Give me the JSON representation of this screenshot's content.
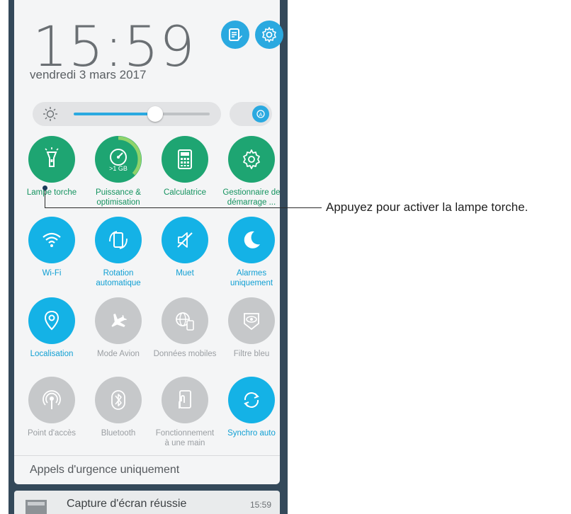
{
  "header": {
    "time": "15:59",
    "date": "vendredi 3 mars 2017",
    "edit_icon": "edit-note-icon",
    "settings_icon": "gear-icon"
  },
  "brightness": {
    "level": 0.6,
    "auto_icon": "auto-brightness-icon"
  },
  "tiles": [
    {
      "label": "Lampe torche",
      "icon": "flashlight-icon",
      "state": "green"
    },
    {
      "label": "Puissance & optimisation",
      "icon": "speedometer-icon",
      "state": "green",
      "badge": ">1 GB"
    },
    {
      "label": "Calculatrice",
      "icon": "calculator-icon",
      "state": "green"
    },
    {
      "label": "Gestionnaire de démarrage ...",
      "icon": "startup-gear-icon",
      "state": "green"
    },
    {
      "label": "Wi-Fi",
      "icon": "wifi-icon",
      "state": "blue"
    },
    {
      "label": "Rotation automatique",
      "icon": "rotation-icon",
      "state": "blue"
    },
    {
      "label": "Muet",
      "icon": "mute-icon",
      "state": "blue"
    },
    {
      "label": "Alarmes uniquement",
      "icon": "moon-icon",
      "state": "blue"
    },
    {
      "label": "Localisation",
      "icon": "location-pin-icon",
      "state": "blue"
    },
    {
      "label": "Mode Avion",
      "icon": "airplane-icon",
      "state": "gray"
    },
    {
      "label": "Données mobiles",
      "icon": "mobile-data-icon",
      "state": "gray"
    },
    {
      "label": "Filtre bleu",
      "icon": "eye-filter-icon",
      "state": "gray"
    },
    {
      "label": "Point d'accès",
      "icon": "hotspot-icon",
      "state": "gray"
    },
    {
      "label": "Bluetooth",
      "icon": "bluetooth-icon",
      "state": "gray"
    },
    {
      "label": "Fonctionnement à une main",
      "icon": "one-hand-icon",
      "state": "gray"
    },
    {
      "label": "Synchro auto",
      "icon": "sync-icon",
      "state": "blue"
    }
  ],
  "footer": {
    "emergency": "Appels d'urgence uniquement"
  },
  "notification": {
    "title": "Capture d'écran réussie",
    "time": "15:59"
  },
  "callout": {
    "text": "Appuyez pour activer la lampe torche."
  },
  "colors": {
    "green": "#1ea572",
    "blue": "#14b2e6",
    "gray": "#c6c8ca",
    "frame": "#34495a"
  }
}
